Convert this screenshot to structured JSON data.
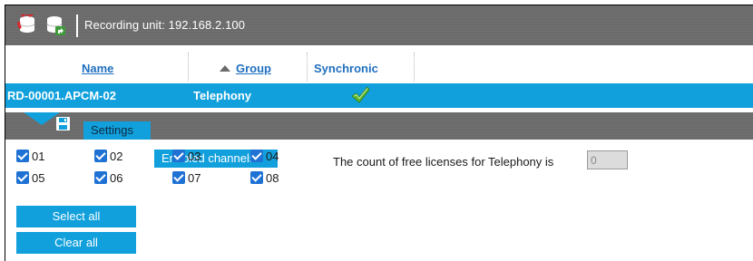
{
  "toolbar": {
    "title": "Recording unit: 192.168.2.100",
    "icons": [
      "database-refresh-icon",
      "database-export-icon"
    ]
  },
  "table": {
    "headers": {
      "name": "Name",
      "group": "Group",
      "synchronic": "Synchronic",
      "sort_icon": "sort-ascending-icon"
    },
    "rows": [
      {
        "name": "RD-00001.APCM-02",
        "group": "Telephony",
        "synchronic": true
      }
    ]
  },
  "panel": {
    "tabs": [
      {
        "label": "Settings"
      },
      {
        "label": "Enabled channels"
      }
    ]
  },
  "channels": [
    {
      "label": "01",
      "checked": true
    },
    {
      "label": "02",
      "checked": true
    },
    {
      "label": "03",
      "checked": true
    },
    {
      "label": "04",
      "checked": true
    },
    {
      "label": "05",
      "checked": true
    },
    {
      "label": "06",
      "checked": true
    },
    {
      "label": "07",
      "checked": true
    },
    {
      "label": "08",
      "checked": true
    }
  ],
  "license": {
    "text": "The count of free licenses for Telephony is",
    "value": "0"
  },
  "buttons": {
    "select_all": "Select all",
    "clear_all": "Clear all"
  },
  "colors": {
    "accent": "#11a0dc",
    "toolbar": "#6b6b6b",
    "checkbox": "#1f72d4",
    "link": "#1f6fbf",
    "check_green": "#5cb82e"
  }
}
